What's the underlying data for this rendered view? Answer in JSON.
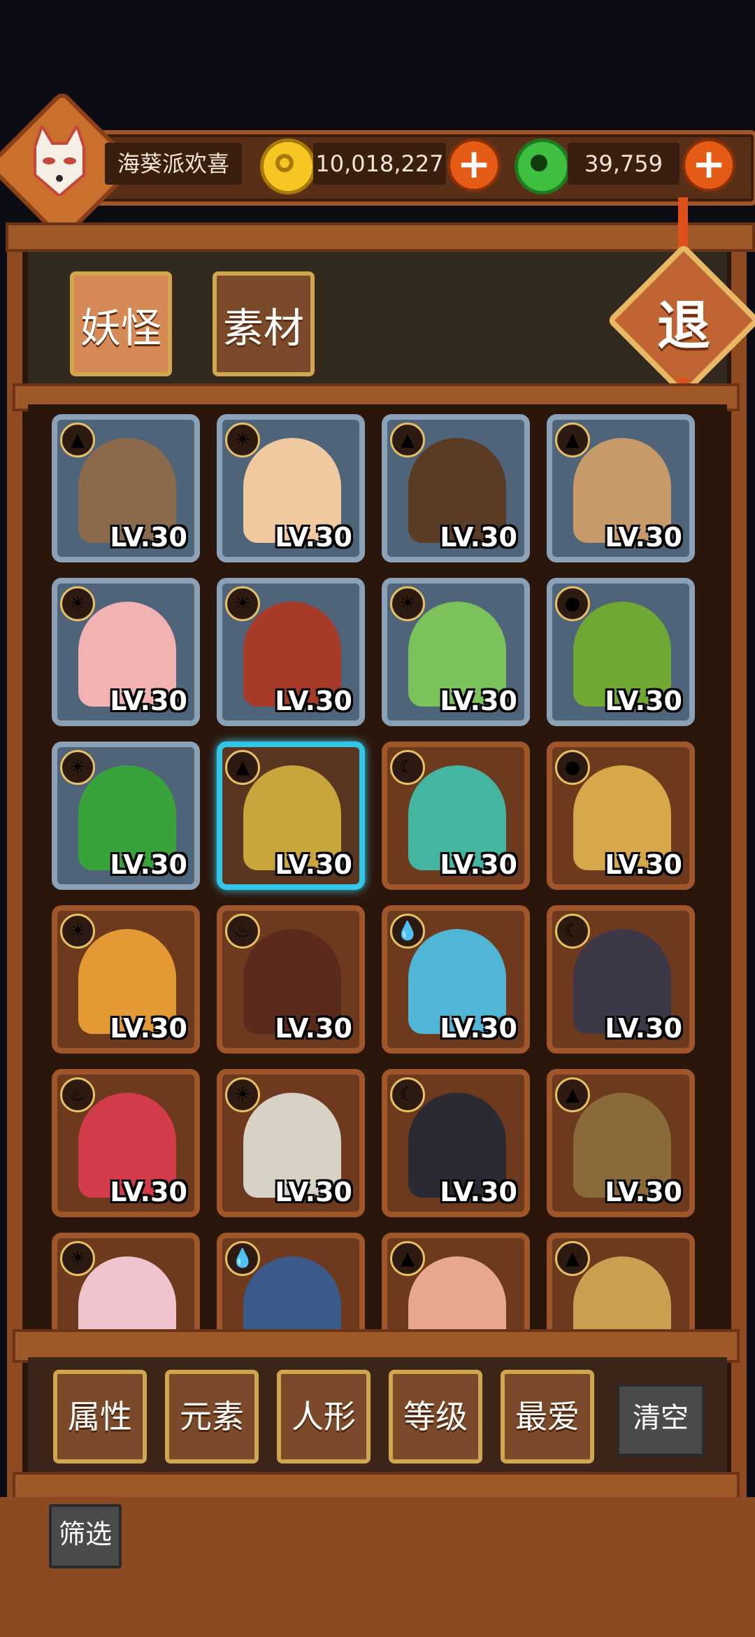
{
  "header": {
    "player_name": "海葵派欢喜",
    "gold_amount": "10,018,227",
    "jade_amount": "39,759",
    "plus_symbol": "+"
  },
  "tabs": [
    {
      "label": "妖怪",
      "active": true
    },
    {
      "label": "素材",
      "active": false
    }
  ],
  "exit_label": "退",
  "cards": [
    {
      "level": "LV.30",
      "element": "earth",
      "frame": "silver",
      "color": "#8a6a4a"
    },
    {
      "level": "LV.30",
      "element": "sun",
      "frame": "silver",
      "color": "#f0c9a0"
    },
    {
      "level": "LV.30",
      "element": "earth",
      "frame": "silver",
      "color": "#5a3c24"
    },
    {
      "level": "LV.30",
      "element": "earth",
      "frame": "silver",
      "color": "#c79a6a"
    },
    {
      "level": "LV.30",
      "element": "sun",
      "frame": "silver",
      "color": "#f2b2b2"
    },
    {
      "level": "LV.30",
      "element": "sun",
      "frame": "silver",
      "color": "#a83a2a"
    },
    {
      "level": "LV.30",
      "element": "sun",
      "frame": "silver",
      "color": "#7bc25a"
    },
    {
      "level": "LV.30",
      "element": "wood",
      "frame": "silver",
      "color": "#6fa934"
    },
    {
      "level": "LV.30",
      "element": "sun",
      "frame": "silver",
      "color": "#39a33b"
    },
    {
      "level": "LV.30",
      "element": "earth",
      "frame": "selected",
      "color": "#c9a63b"
    },
    {
      "level": "LV.30",
      "element": "moon",
      "frame": "bronze",
      "color": "#43b5a0"
    },
    {
      "level": "LV.30",
      "element": "wood",
      "frame": "bronze",
      "color": "#d6a84a"
    },
    {
      "level": "LV.30",
      "element": "sun",
      "frame": "bronze",
      "color": "#e39a35"
    },
    {
      "level": "LV.30",
      "element": "fire",
      "frame": "bronze",
      "color": "#5a2a1c"
    },
    {
      "level": "LV.30",
      "element": "water",
      "frame": "bronze",
      "color": "#4fb6d6"
    },
    {
      "level": "LV.30",
      "element": "moon",
      "frame": "bronze",
      "color": "#3c3848"
    },
    {
      "level": "LV.30",
      "element": "fire",
      "frame": "bronze",
      "color": "#d23b4a"
    },
    {
      "level": "LV.30",
      "element": "sun",
      "frame": "bronze",
      "color": "#d8d2c6"
    },
    {
      "level": "LV.30",
      "element": "moon",
      "frame": "bronze",
      "color": "#2a2a34"
    },
    {
      "level": "LV.30",
      "element": "earth",
      "frame": "bronze",
      "color": "#8a6a3a"
    },
    {
      "level": "",
      "element": "sun",
      "frame": "bronze",
      "color": "#f0c4cf"
    },
    {
      "level": "",
      "element": "water",
      "frame": "bronze",
      "color": "#3a5a8a"
    },
    {
      "level": "",
      "element": "earth",
      "frame": "bronze",
      "color": "#e8a890"
    },
    {
      "level": "",
      "element": "earth",
      "frame": "bronze",
      "color": "#c9a050"
    }
  ],
  "filters": [
    "属性",
    "元素",
    "人形",
    "等级",
    "最爱"
  ],
  "clear_label": "清空",
  "filter_toggle_label": "筛选",
  "element_icons": {
    "sun": "☀",
    "earth": "▲",
    "moon": "☾",
    "wood": "●",
    "fire": "♨",
    "water": "💧"
  }
}
